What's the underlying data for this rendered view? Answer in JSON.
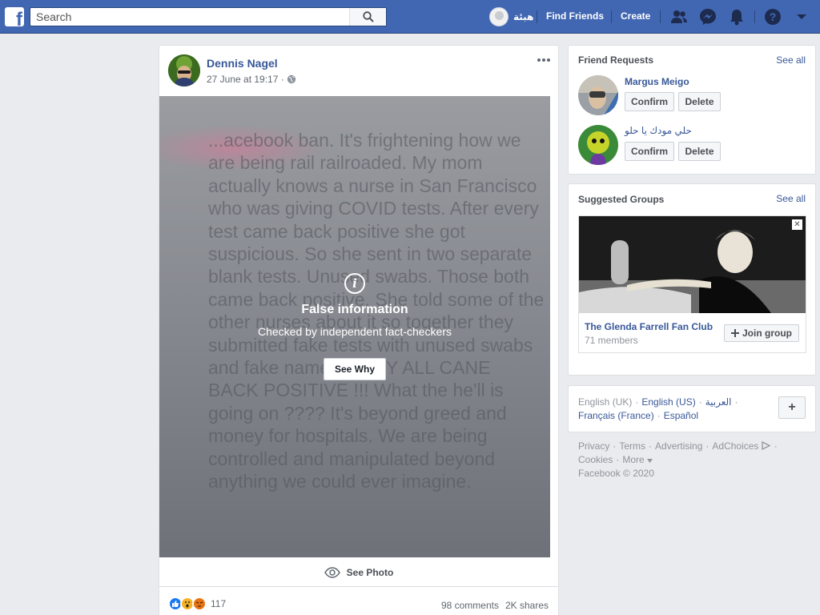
{
  "topbar": {
    "logo": "f",
    "search_placeholder": "Search",
    "profile_name": "هبئة",
    "find_friends": "Find Friends",
    "create": "Create",
    "icons": [
      "friends-icon",
      "messenger-icon",
      "notifications-icon",
      "help-icon",
      "menu-caret-icon"
    ]
  },
  "post": {
    "author": "Dennis Nagel",
    "date": "27 June at 19:17 ·",
    "privacy_icon": "globe-icon",
    "image_text": "...acebook ban. It's frightening how we are being rail railroaded. My mom actually knows a nurse in San Francisco who was giving COVID tests. After every test came back positive she got suspicious. So she sent in two separate blank tests. Unused swabs. Those both came back positive. She told some of the other nurses about it so together they submitted fake tests with unused swabs and fake names. THEY ALL CANE BACK POSITIVE !!! What the he'll is going on ???? It's beyond greed and money for hospitals. We are being controlled and manipulated beyond anything we could ever imagine.",
    "warning_title": "False information",
    "warning_subtitle": "Checked by independent fact-checkers",
    "see_why": "See Why",
    "see_photo": "See Photo",
    "reaction_count": "117",
    "comments": "98 comments",
    "shares": "2K shares"
  },
  "friend_requests": {
    "title": "Friend Requests",
    "see_all": "See all",
    "items": [
      {
        "name": "Margus Meigo",
        "confirm": "Confirm",
        "delete": "Delete"
      },
      {
        "name": "حلي مودك يا حلو",
        "confirm": "Confirm",
        "delete": "Delete"
      }
    ]
  },
  "suggested_groups": {
    "title": "Suggested Groups",
    "see_all": "See all",
    "group_name": "The Glenda Farrell Fan Club",
    "members": "71 members",
    "join": "Join group",
    "close": "✕"
  },
  "languages": {
    "line1": [
      "English (UK)",
      "English (US)",
      "العربية"
    ],
    "line2": [
      "Français (France)",
      "Español"
    ],
    "plus": "+"
  },
  "footer": {
    "links1": [
      "Privacy",
      "Terms",
      "Advertising",
      "AdChoices"
    ],
    "links2": [
      "Cookies",
      "More"
    ],
    "copyright": "Facebook © 2020"
  }
}
